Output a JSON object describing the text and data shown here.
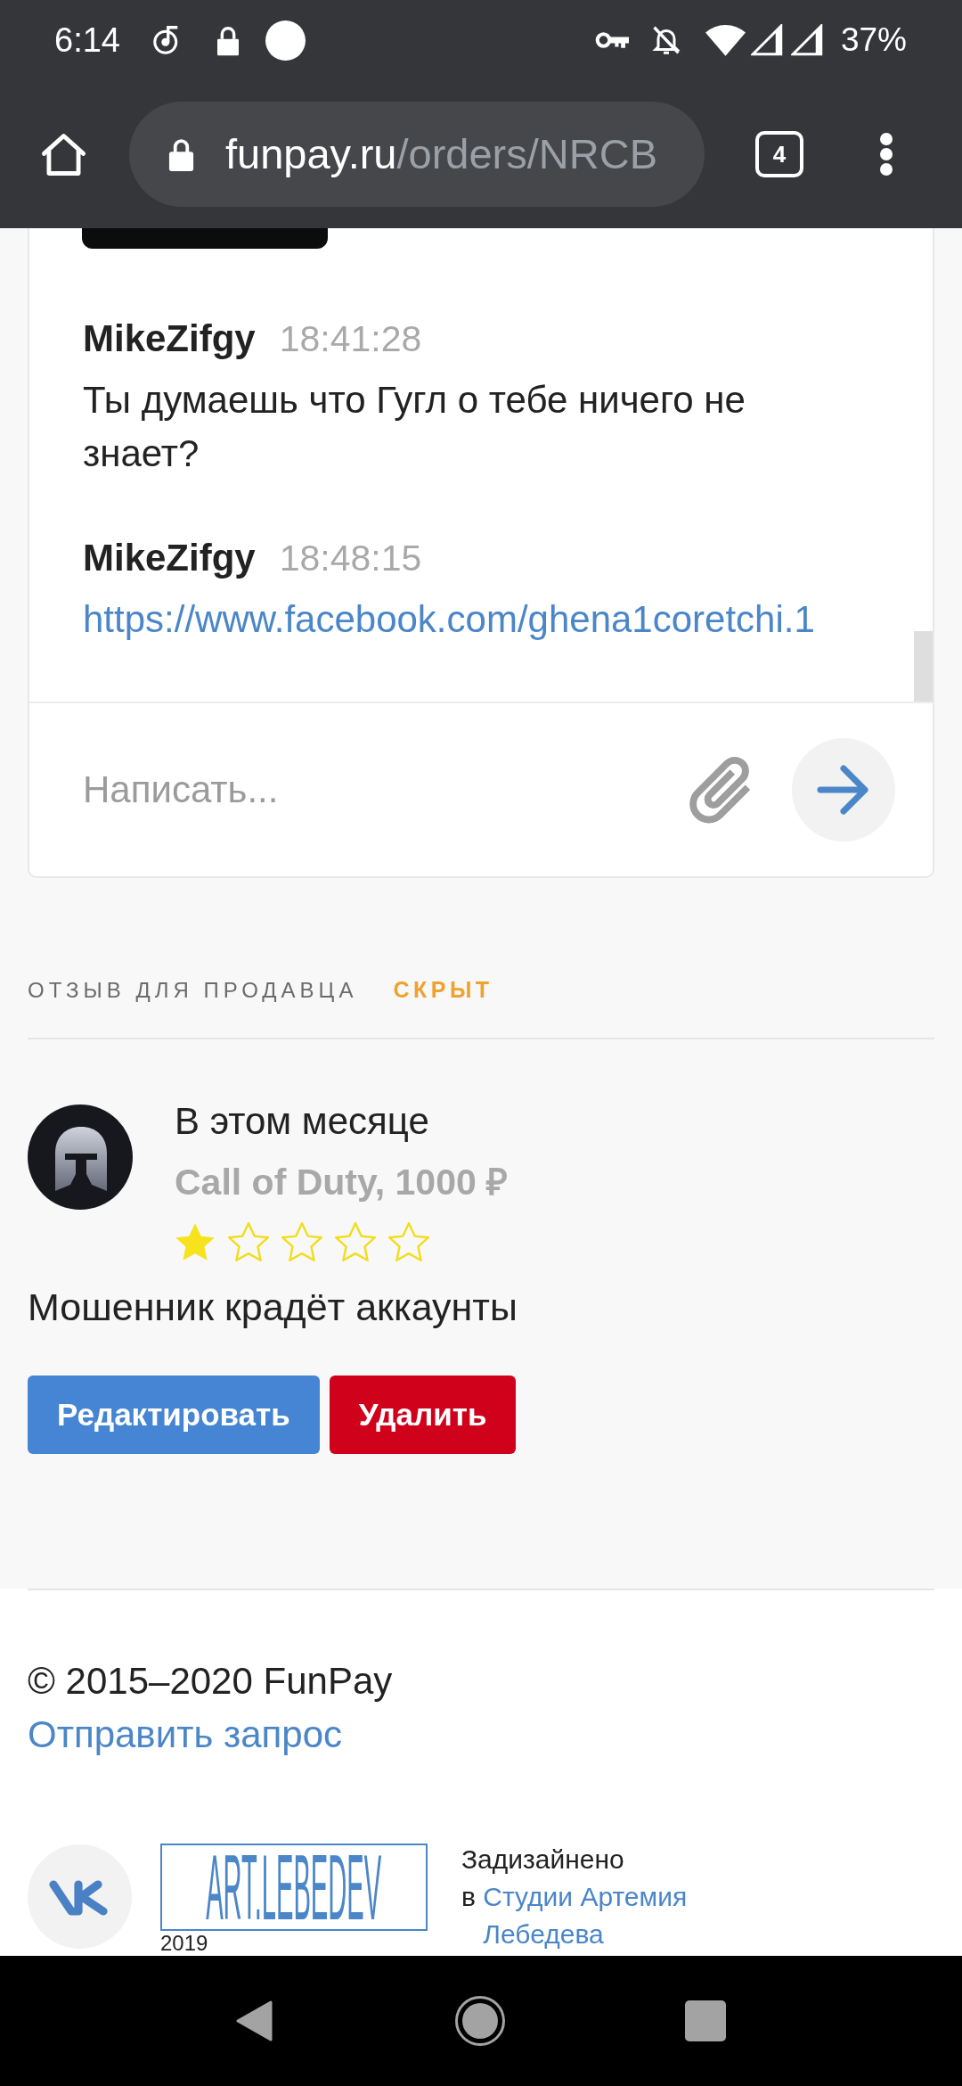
{
  "status_bar": {
    "time": "6:14",
    "battery": "37%"
  },
  "browser_toolbar": {
    "url_host": "funpay.ru",
    "url_path": "/orders/NRCB",
    "tab_count": "4"
  },
  "chat": {
    "messages": [
      {
        "kind": "text",
        "author": "MikeZifgy",
        "time": "18:41:28",
        "text": "Ты думаешь что Гугл о тебе ничего не знает?"
      },
      {
        "kind": "link",
        "author": "MikeZifgy",
        "time": "18:48:15",
        "text": "https://www.facebook.com/ghena1coretchi.1"
      }
    ],
    "composer": {
      "placeholder": "Написать..."
    }
  },
  "seller_review": {
    "heading": "ОТЗЫВ ДЛЯ ПРОДАВЦА",
    "status": "СКРЫТ",
    "date": "В этом месяце",
    "order": "Call of Duty, 1000 ₽",
    "stars": 1,
    "text": "Мошенник крадёт аккаунты",
    "buttons": [
      {
        "kind": "edit",
        "label": "Редактировать"
      },
      {
        "kind": "delete",
        "label": "Удалить"
      }
    ]
  },
  "footer": {
    "copyright": "© 2015–2020 FunPay",
    "support_link": "Отправить запрос",
    "studio_logo": "ART.LEBEDEV",
    "studio_year": "2019",
    "designed_by": "Задизайнено",
    "designed_by_in": "в",
    "designed_by_link": "Студии Артемия Лебедева"
  }
}
